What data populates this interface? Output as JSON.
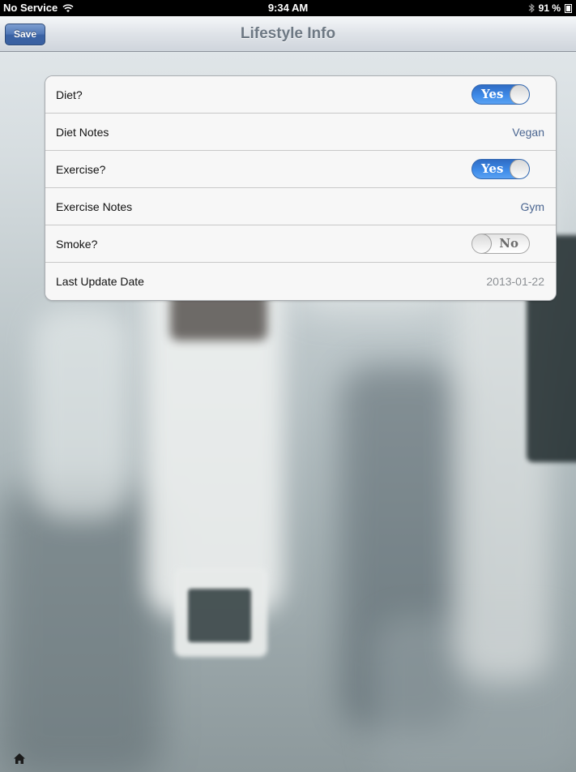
{
  "status_bar": {
    "carrier": "No Service",
    "time": "9:34 AM",
    "battery": "91 %"
  },
  "nav": {
    "title": "Lifestyle Info",
    "save_label": "Save"
  },
  "form": {
    "diet": {
      "label": "Diet?",
      "state": "Yes"
    },
    "diet_notes": {
      "label": "Diet Notes",
      "value": "Vegan"
    },
    "exercise": {
      "label": "Exercise?",
      "state": "Yes"
    },
    "exercise_notes": {
      "label": "Exercise Notes",
      "value": "Gym"
    },
    "smoke": {
      "label": "Smoke?",
      "state": "No"
    },
    "last_update": {
      "label": "Last Update Date",
      "value": "2013-01-22"
    }
  },
  "icons": {
    "home": "home-icon",
    "wifi": "wifi-icon",
    "bluetooth": "bluetooth-icon",
    "battery": "battery-icon"
  },
  "colors": {
    "switch_on": "#3d8ae8",
    "save_button": "#4f76b6",
    "value_text": "#4a6590"
  }
}
